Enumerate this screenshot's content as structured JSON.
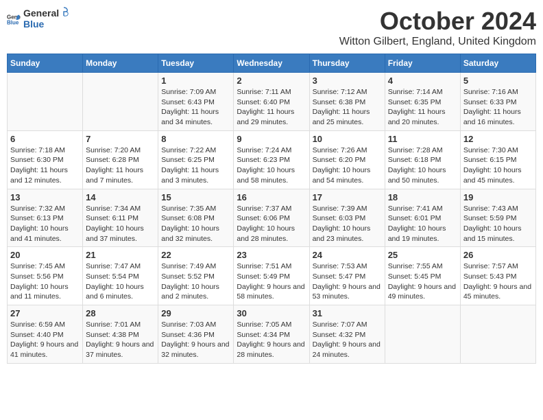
{
  "logo": {
    "general": "General",
    "blue": "Blue"
  },
  "title": "October 2024",
  "location": "Witton Gilbert, England, United Kingdom",
  "days_header": [
    "Sunday",
    "Monday",
    "Tuesday",
    "Wednesday",
    "Thursday",
    "Friday",
    "Saturday"
  ],
  "weeks": [
    [
      {
        "num": "",
        "sunrise": "",
        "sunset": "",
        "daylight": ""
      },
      {
        "num": "",
        "sunrise": "",
        "sunset": "",
        "daylight": ""
      },
      {
        "num": "1",
        "sunrise": "Sunrise: 7:09 AM",
        "sunset": "Sunset: 6:43 PM",
        "daylight": "Daylight: 11 hours and 34 minutes."
      },
      {
        "num": "2",
        "sunrise": "Sunrise: 7:11 AM",
        "sunset": "Sunset: 6:40 PM",
        "daylight": "Daylight: 11 hours and 29 minutes."
      },
      {
        "num": "3",
        "sunrise": "Sunrise: 7:12 AM",
        "sunset": "Sunset: 6:38 PM",
        "daylight": "Daylight: 11 hours and 25 minutes."
      },
      {
        "num": "4",
        "sunrise": "Sunrise: 7:14 AM",
        "sunset": "Sunset: 6:35 PM",
        "daylight": "Daylight: 11 hours and 20 minutes."
      },
      {
        "num": "5",
        "sunrise": "Sunrise: 7:16 AM",
        "sunset": "Sunset: 6:33 PM",
        "daylight": "Daylight: 11 hours and 16 minutes."
      }
    ],
    [
      {
        "num": "6",
        "sunrise": "Sunrise: 7:18 AM",
        "sunset": "Sunset: 6:30 PM",
        "daylight": "Daylight: 11 hours and 12 minutes."
      },
      {
        "num": "7",
        "sunrise": "Sunrise: 7:20 AM",
        "sunset": "Sunset: 6:28 PM",
        "daylight": "Daylight: 11 hours and 7 minutes."
      },
      {
        "num": "8",
        "sunrise": "Sunrise: 7:22 AM",
        "sunset": "Sunset: 6:25 PM",
        "daylight": "Daylight: 11 hours and 3 minutes."
      },
      {
        "num": "9",
        "sunrise": "Sunrise: 7:24 AM",
        "sunset": "Sunset: 6:23 PM",
        "daylight": "Daylight: 10 hours and 58 minutes."
      },
      {
        "num": "10",
        "sunrise": "Sunrise: 7:26 AM",
        "sunset": "Sunset: 6:20 PM",
        "daylight": "Daylight: 10 hours and 54 minutes."
      },
      {
        "num": "11",
        "sunrise": "Sunrise: 7:28 AM",
        "sunset": "Sunset: 6:18 PM",
        "daylight": "Daylight: 10 hours and 50 minutes."
      },
      {
        "num": "12",
        "sunrise": "Sunrise: 7:30 AM",
        "sunset": "Sunset: 6:15 PM",
        "daylight": "Daylight: 10 hours and 45 minutes."
      }
    ],
    [
      {
        "num": "13",
        "sunrise": "Sunrise: 7:32 AM",
        "sunset": "Sunset: 6:13 PM",
        "daylight": "Daylight: 10 hours and 41 minutes."
      },
      {
        "num": "14",
        "sunrise": "Sunrise: 7:34 AM",
        "sunset": "Sunset: 6:11 PM",
        "daylight": "Daylight: 10 hours and 37 minutes."
      },
      {
        "num": "15",
        "sunrise": "Sunrise: 7:35 AM",
        "sunset": "Sunset: 6:08 PM",
        "daylight": "Daylight: 10 hours and 32 minutes."
      },
      {
        "num": "16",
        "sunrise": "Sunrise: 7:37 AM",
        "sunset": "Sunset: 6:06 PM",
        "daylight": "Daylight: 10 hours and 28 minutes."
      },
      {
        "num": "17",
        "sunrise": "Sunrise: 7:39 AM",
        "sunset": "Sunset: 6:03 PM",
        "daylight": "Daylight: 10 hours and 23 minutes."
      },
      {
        "num": "18",
        "sunrise": "Sunrise: 7:41 AM",
        "sunset": "Sunset: 6:01 PM",
        "daylight": "Daylight: 10 hours and 19 minutes."
      },
      {
        "num": "19",
        "sunrise": "Sunrise: 7:43 AM",
        "sunset": "Sunset: 5:59 PM",
        "daylight": "Daylight: 10 hours and 15 minutes."
      }
    ],
    [
      {
        "num": "20",
        "sunrise": "Sunrise: 7:45 AM",
        "sunset": "Sunset: 5:56 PM",
        "daylight": "Daylight: 10 hours and 11 minutes."
      },
      {
        "num": "21",
        "sunrise": "Sunrise: 7:47 AM",
        "sunset": "Sunset: 5:54 PM",
        "daylight": "Daylight: 10 hours and 6 minutes."
      },
      {
        "num": "22",
        "sunrise": "Sunrise: 7:49 AM",
        "sunset": "Sunset: 5:52 PM",
        "daylight": "Daylight: 10 hours and 2 minutes."
      },
      {
        "num": "23",
        "sunrise": "Sunrise: 7:51 AM",
        "sunset": "Sunset: 5:49 PM",
        "daylight": "Daylight: 9 hours and 58 minutes."
      },
      {
        "num": "24",
        "sunrise": "Sunrise: 7:53 AM",
        "sunset": "Sunset: 5:47 PM",
        "daylight": "Daylight: 9 hours and 53 minutes."
      },
      {
        "num": "25",
        "sunrise": "Sunrise: 7:55 AM",
        "sunset": "Sunset: 5:45 PM",
        "daylight": "Daylight: 9 hours and 49 minutes."
      },
      {
        "num": "26",
        "sunrise": "Sunrise: 7:57 AM",
        "sunset": "Sunset: 5:43 PM",
        "daylight": "Daylight: 9 hours and 45 minutes."
      }
    ],
    [
      {
        "num": "27",
        "sunrise": "Sunrise: 6:59 AM",
        "sunset": "Sunset: 4:40 PM",
        "daylight": "Daylight: 9 hours and 41 minutes."
      },
      {
        "num": "28",
        "sunrise": "Sunrise: 7:01 AM",
        "sunset": "Sunset: 4:38 PM",
        "daylight": "Daylight: 9 hours and 37 minutes."
      },
      {
        "num": "29",
        "sunrise": "Sunrise: 7:03 AM",
        "sunset": "Sunset: 4:36 PM",
        "daylight": "Daylight: 9 hours and 32 minutes."
      },
      {
        "num": "30",
        "sunrise": "Sunrise: 7:05 AM",
        "sunset": "Sunset: 4:34 PM",
        "daylight": "Daylight: 9 hours and 28 minutes."
      },
      {
        "num": "31",
        "sunrise": "Sunrise: 7:07 AM",
        "sunset": "Sunset: 4:32 PM",
        "daylight": "Daylight: 9 hours and 24 minutes."
      },
      {
        "num": "",
        "sunrise": "",
        "sunset": "",
        "daylight": ""
      },
      {
        "num": "",
        "sunrise": "",
        "sunset": "",
        "daylight": ""
      }
    ]
  ]
}
